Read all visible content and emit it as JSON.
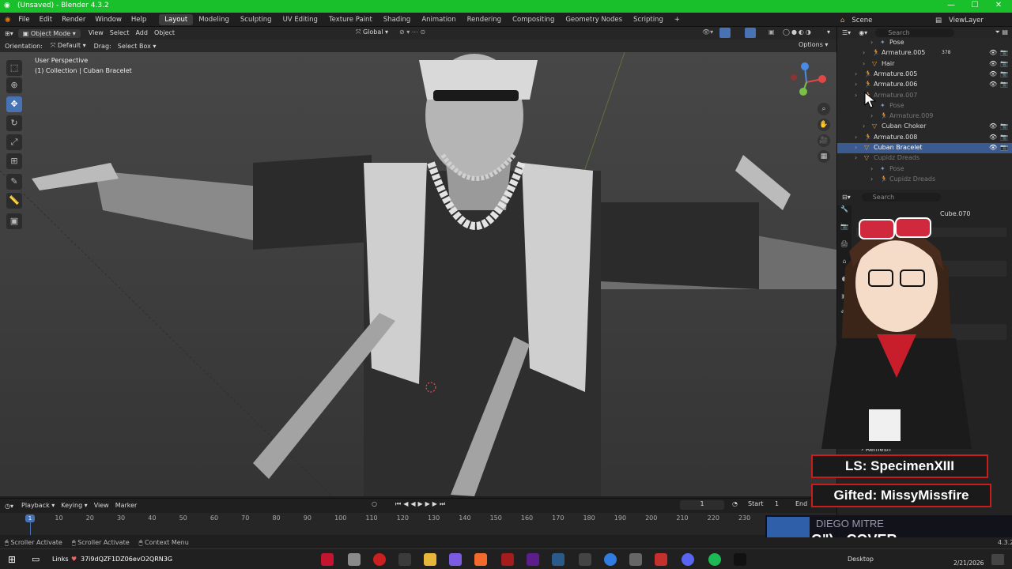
{
  "window": {
    "title": "(Unsaved) - Blender 4.3.2"
  },
  "menu": [
    "File",
    "Edit",
    "Render",
    "Window",
    "Help"
  ],
  "workspaces": [
    "Layout",
    "Modeling",
    "Sculpting",
    "UV Editing",
    "Texture Paint",
    "Shading",
    "Animation",
    "Rendering",
    "Compositing",
    "Geometry Nodes",
    "Scripting"
  ],
  "active_workspace": "Layout",
  "scene": {
    "label": "Scene",
    "view_layer": "ViewLayer"
  },
  "header": {
    "mode": "Object Mode",
    "view": "View",
    "select": "Select",
    "add": "Add",
    "object": "Object",
    "transform": "Global"
  },
  "toolsettings": {
    "orientation_label": "Orientation:",
    "orientation_value": "Default",
    "drag_label": "Drag:",
    "drag_value": "Select Box",
    "options": "Options"
  },
  "viewport": {
    "perspective": "User Perspective",
    "collection": "(1) Collection | Cuban Bracelet"
  },
  "outliner": {
    "search_placeholder": "Search",
    "rows": [
      {
        "label": "Pose",
        "indent": 3,
        "dim": false,
        "icon": "pose"
      },
      {
        "label": "Armature.005",
        "indent": 2,
        "dim": false,
        "icon": "armature",
        "extra": "378"
      },
      {
        "label": "Hair",
        "indent": 2,
        "dim": false,
        "icon": "mesh"
      },
      {
        "label": "Armature.005",
        "indent": 1,
        "dim": false,
        "icon": "armature"
      },
      {
        "label": "Armature.006",
        "indent": 1,
        "dim": false,
        "icon": "armature"
      },
      {
        "label": "Armature.007",
        "indent": 1,
        "dim": true,
        "icon": "armature"
      },
      {
        "label": "Pose",
        "indent": 3,
        "dim": true,
        "icon": "pose"
      },
      {
        "label": "Armature.009",
        "indent": 3,
        "dim": true,
        "icon": "armature"
      },
      {
        "label": "Cuban Choker",
        "indent": 2,
        "dim": false,
        "icon": "mesh"
      },
      {
        "label": "Armature.008",
        "indent": 1,
        "dim": false,
        "icon": "armature"
      },
      {
        "label": "Cuban Bracelet",
        "indent": 1,
        "dim": false,
        "icon": "mesh",
        "selected": true
      },
      {
        "label": "Cupidz Dreads",
        "indent": 1,
        "dim": true,
        "icon": "mesh"
      },
      {
        "label": "Pose",
        "indent": 3,
        "dim": true,
        "icon": "pose"
      },
      {
        "label": "Cupidz Dreads",
        "indent": 3,
        "dim": true,
        "icon": "armature"
      }
    ]
  },
  "properties": {
    "object_name": "Cube.070",
    "search_placeholder": "Search",
    "remesh": "Remesh"
  },
  "timeline": {
    "playback": "Playback",
    "keying": "Keying",
    "view": "View",
    "marker": "Marker",
    "current_frame": "1",
    "start_label": "Start",
    "start": "1",
    "end_label": "End",
    "ticks": [
      "1",
      "10",
      "20",
      "30",
      "40",
      "50",
      "60",
      "70",
      "80",
      "90",
      "100",
      "110",
      "120",
      "130",
      "140",
      "150",
      "160",
      "170",
      "180",
      "190",
      "200",
      "210",
      "220",
      "230"
    ]
  },
  "status": {
    "left": "Scroller Activate",
    "middle": "Scroller Activate",
    "right": "Context Menu",
    "version": "4.3.2"
  },
  "overlay": {
    "ls": "LS: SpecimenXIII",
    "gifted": "Gifted: MissyMissfire",
    "artist": "DIEGO MITRE",
    "song": "G\") - COVER"
  },
  "taskbar": {
    "links": "Links",
    "clip": "37i9dQZF1DZ06evO2QRN3G",
    "desktop": "Desktop",
    "date": "2/21/2026"
  }
}
